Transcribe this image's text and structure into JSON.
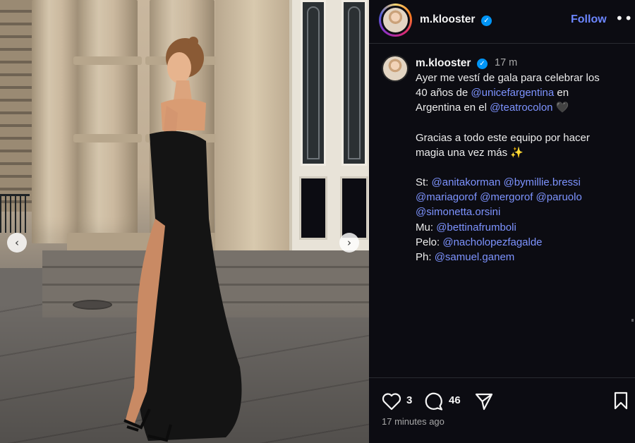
{
  "post": {
    "photo": {
      "prev_glyph": "‹",
      "next_glyph": "›"
    },
    "header": {
      "username": "m.klooster",
      "verified_glyph": "✓",
      "follow_label": "Follow",
      "more_glyph": "•••"
    },
    "caption": {
      "username": "m.klooster",
      "time_ago": "17 m",
      "lines": [
        {
          "parts": [
            {
              "text": "Ayer me vestí de gala para celebrar los"
            }
          ]
        },
        {
          "parts": [
            {
              "text": "40 años de "
            },
            {
              "text": "@unicefargentina",
              "mention": true
            },
            {
              "text": " en"
            }
          ]
        },
        {
          "parts": [
            {
              "text": "Argentina en el "
            },
            {
              "text": "@teatrocolon",
              "mention": true
            },
            {
              "text": " 🖤"
            }
          ]
        },
        {
          "gap": true
        },
        {
          "parts": [
            {
              "text": "Gracias a todo este equipo por hacer"
            }
          ]
        },
        {
          "parts": [
            {
              "text": "magia una vez más ✨"
            }
          ]
        },
        {
          "gap": true
        },
        {
          "parts": [
            {
              "text": "St: "
            },
            {
              "text": "@anitakorman",
              "mention": true
            },
            {
              "text": " "
            },
            {
              "text": "@bymillie.bressi",
              "mention": true
            }
          ]
        },
        {
          "parts": [
            {
              "text": "@mariagorof",
              "mention": true
            },
            {
              "text": " "
            },
            {
              "text": "@mergorof",
              "mention": true
            },
            {
              "text": " "
            },
            {
              "text": "@paruolo",
              "mention": true
            }
          ]
        },
        {
          "parts": [
            {
              "text": "@simonetta.orsini",
              "mention": true
            }
          ]
        },
        {
          "parts": [
            {
              "text": "Mu: "
            },
            {
              "text": "@bettinafrumboli",
              "mention": true
            }
          ]
        },
        {
          "parts": [
            {
              "text": "Pelo: "
            },
            {
              "text": "@nacholopezfagalde",
              "mention": true
            }
          ]
        },
        {
          "parts": [
            {
              "text": "Ph: "
            },
            {
              "text": "@samuel.ganem",
              "mention": true
            }
          ]
        }
      ]
    },
    "actions": {
      "like_icon": "heart-icon",
      "like_count": "3",
      "comment_icon": "comment-icon",
      "comment_count": "46",
      "share_icon": "share-icon",
      "save_icon": "bookmark-icon",
      "timestamp": "17 minutes ago"
    }
  },
  "colors": {
    "panel_bg": "#0c0c12",
    "mention": "#7d93ff",
    "follow": "#6c86ff",
    "verified": "#0095f6",
    "muted": "#a8a8a8"
  }
}
